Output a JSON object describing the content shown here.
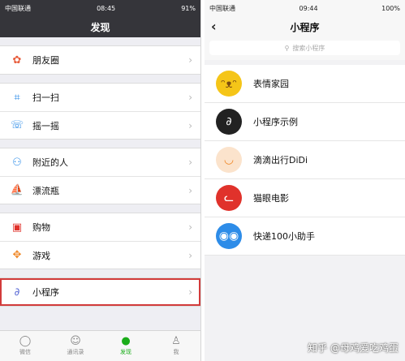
{
  "left": {
    "status": {
      "carrier": "中国联通",
      "time": "08:45",
      "battery": "91%"
    },
    "title": "发现",
    "groups": [
      [
        {
          "label": "朋友圈",
          "icon": "moments-icon"
        }
      ],
      [
        {
          "label": "扫一扫",
          "icon": "scan-icon"
        },
        {
          "label": "摇一摇",
          "icon": "shake-icon"
        }
      ],
      [
        {
          "label": "附近的人",
          "icon": "people-nearby-icon"
        },
        {
          "label": "漂流瓶",
          "icon": "drift-bottle-icon"
        }
      ],
      [
        {
          "label": "购物",
          "icon": "shopping-icon"
        },
        {
          "label": "游戏",
          "icon": "games-icon"
        }
      ],
      [
        {
          "label": "小程序",
          "icon": "mini-program-icon"
        }
      ]
    ],
    "tabs": [
      {
        "label": "微信",
        "icon": "chat-icon"
      },
      {
        "label": "通讯录",
        "icon": "contacts-icon"
      },
      {
        "label": "发现",
        "icon": "discover-icon"
      },
      {
        "label": "我",
        "icon": "me-icon"
      }
    ]
  },
  "right": {
    "status": {
      "carrier": "中国联通",
      "time": "09:44",
      "battery": "100%"
    },
    "title": "小程序",
    "search_placeholder": "搜索小程序",
    "apps": [
      {
        "label": "表情家园",
        "icon": "emoji-home-icon",
        "color": "#f5c518"
      },
      {
        "label": "小程序示例",
        "icon": "mini-program-demo-icon",
        "color": "#222222"
      },
      {
        "label": "滴滴出行DiDi",
        "icon": "didi-icon",
        "color": "#f08a2b"
      },
      {
        "label": "猫眼电影",
        "icon": "maoyan-icon",
        "color": "#e0322b"
      },
      {
        "label": "快递100小助手",
        "icon": "kuaidi100-icon",
        "color": "#2d8ce8"
      }
    ]
  },
  "watermark": "知乎 @母鸡爱吃鸡蛋",
  "colors": {
    "highlight": "#d23b3b",
    "active_tab": "#1aad19"
  }
}
